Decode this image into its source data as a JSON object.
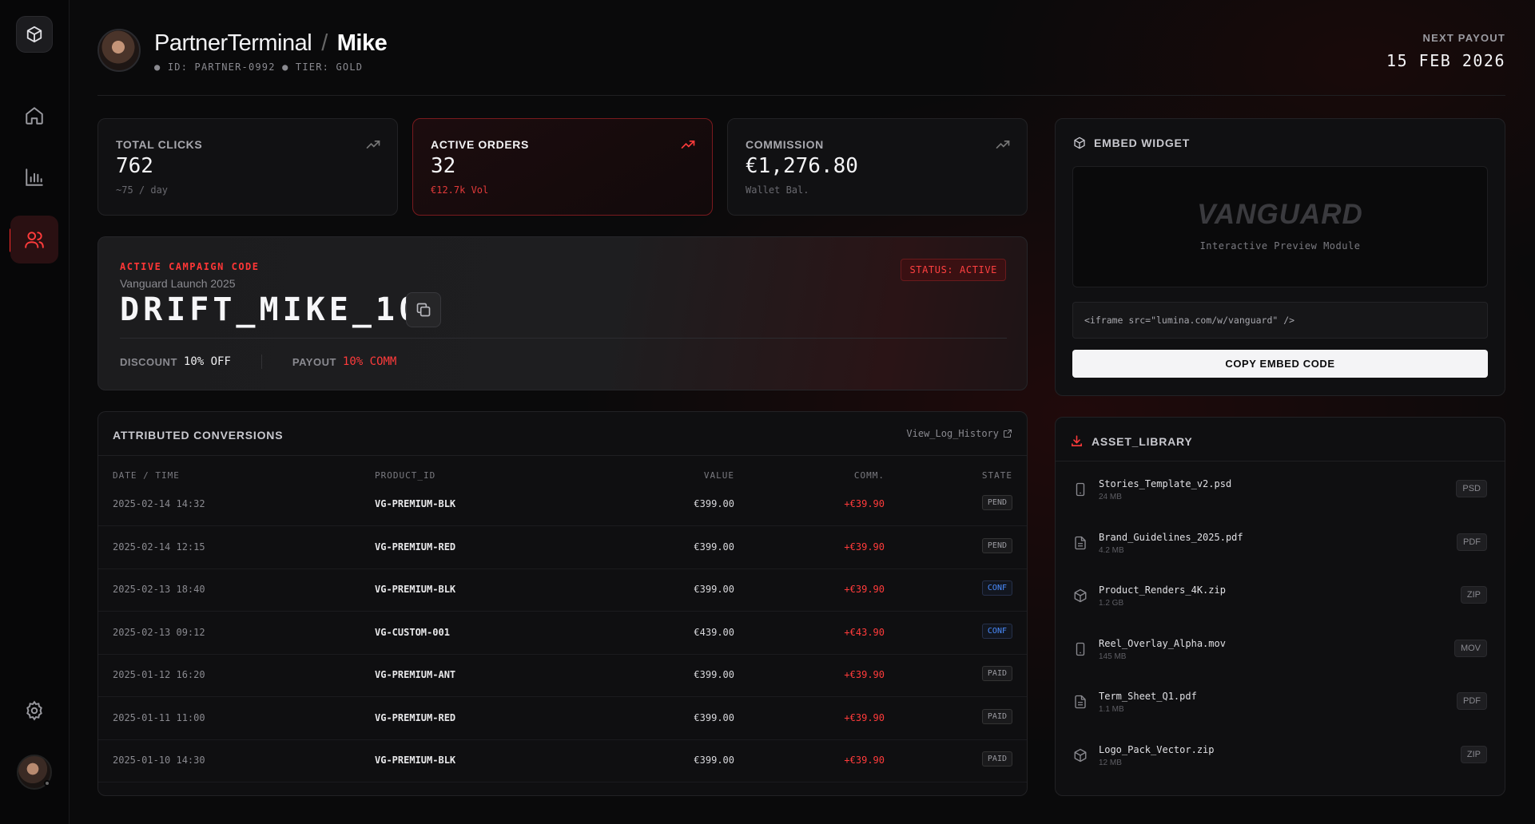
{
  "header": {
    "app_name": "PartnerTerminal",
    "separator": "/",
    "user_name": "Mike",
    "subtitle": "● ID: PARTNER-0992 ● TIER: GOLD",
    "next_payout_label": "NEXT PAYOUT",
    "next_payout_date": "15 FEB 2026"
  },
  "sidebar": {
    "items": [
      {
        "name": "logo",
        "icon": "cube-icon"
      },
      {
        "name": "home",
        "icon": "home-icon"
      },
      {
        "name": "analytics",
        "icon": "bar-chart-icon"
      },
      {
        "name": "partners",
        "icon": "users-icon",
        "active": true
      },
      {
        "name": "settings",
        "icon": "gear-icon"
      }
    ]
  },
  "stats": [
    {
      "label": "TOTAL CLICKS",
      "value": "762",
      "sub": "~75 / day"
    },
    {
      "label": "ACTIVE ORDERS",
      "value": "32",
      "sub": "€12.7k Vol"
    },
    {
      "label": "COMMISSION",
      "value": "€1,276.80",
      "sub": "Wallet Bal."
    }
  ],
  "campaign": {
    "label": "ACTIVE CAMPAIGN CODE",
    "name": "Vanguard Launch 2025",
    "code": "DRIFT_MIKE_10",
    "status": "STATUS: ACTIVE",
    "discount_label": "DISCOUNT",
    "discount_value": "10% OFF",
    "payout_label": "PAYOUT",
    "payout_value": "10% COMM"
  },
  "conversions": {
    "title": "ATTRIBUTED CONVERSIONS",
    "history_link": "View_Log_History",
    "columns": [
      "DATE / TIME",
      "PRODUCT_ID",
      "VALUE",
      "COMM.",
      "STATE"
    ],
    "rows": [
      {
        "date": "2025-02-14 14:32",
        "product": "VG-PREMIUM-BLK",
        "value": "€399.00",
        "comm": "+€39.90",
        "state": "PEND"
      },
      {
        "date": "2025-02-14 12:15",
        "product": "VG-PREMIUM-RED",
        "value": "€399.00",
        "comm": "+€39.90",
        "state": "PEND"
      },
      {
        "date": "2025-02-13 18:40",
        "product": "VG-PREMIUM-BLK",
        "value": "€399.00",
        "comm": "+€39.90",
        "state": "CONF"
      },
      {
        "date": "2025-02-13 09:12",
        "product": "VG-CUSTOM-001",
        "value": "€439.00",
        "comm": "+€43.90",
        "state": "CONF"
      },
      {
        "date": "2025-01-12 16:20",
        "product": "VG-PREMIUM-ANT",
        "value": "€399.00",
        "comm": "+€39.90",
        "state": "PAID"
      },
      {
        "date": "2025-01-11 11:00",
        "product": "VG-PREMIUM-RED",
        "value": "€399.00",
        "comm": "+€39.90",
        "state": "PAID"
      },
      {
        "date": "2025-01-10 14:30",
        "product": "VG-PREMIUM-BLK",
        "value": "€399.00",
        "comm": "+€39.90",
        "state": "PAID"
      }
    ]
  },
  "embed": {
    "title": "EMBED WIDGET",
    "preview_brand": "VANGUARD",
    "preview_sub": "Interactive Preview Module",
    "code": "<iframe src=\"lumina.com/w/vanguard\" />",
    "button": "COPY EMBED CODE"
  },
  "assets": {
    "title": "ASSET_LIBRARY",
    "items": [
      {
        "name": "Stories_Template_v2.psd",
        "size": "24 MB",
        "tag": "PSD",
        "icon": "phone-icon"
      },
      {
        "name": "Brand_Guidelines_2025.pdf",
        "size": "4.2 MB",
        "tag": "PDF",
        "icon": "document-icon"
      },
      {
        "name": "Product_Renders_4K.zip",
        "size": "1.2 GB",
        "tag": "ZIP",
        "icon": "package-icon"
      },
      {
        "name": "Reel_Overlay_Alpha.mov",
        "size": "145 MB",
        "tag": "MOV",
        "icon": "phone-icon"
      },
      {
        "name": "Term_Sheet_Q1.pdf",
        "size": "1.1 MB",
        "tag": "PDF",
        "icon": "document-icon"
      },
      {
        "name": "Logo_Pack_Vector.zip",
        "size": "12 MB",
        "tag": "ZIP",
        "icon": "package-icon"
      }
    ]
  },
  "colors": {
    "accent": "#ff3b3b",
    "background": "#0a0a0b",
    "confirmed": "#4a8cff"
  }
}
